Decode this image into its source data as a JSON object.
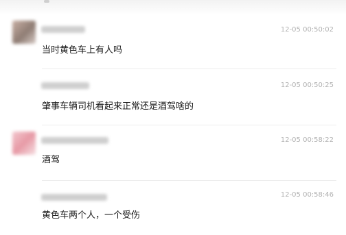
{
  "comments": [
    {
      "time": "12-05 00:50:02",
      "text": "当时黄色车上有人吗"
    },
    {
      "time": "12-05 00:50:25",
      "text": "肇事车辆司机看起来正常还是酒驾啥的"
    },
    {
      "time": "12-05 00:58:22",
      "text": "酒驾"
    },
    {
      "time": "12-05 00:58:46",
      "text": "黄色车两个人，一个受伤"
    }
  ]
}
